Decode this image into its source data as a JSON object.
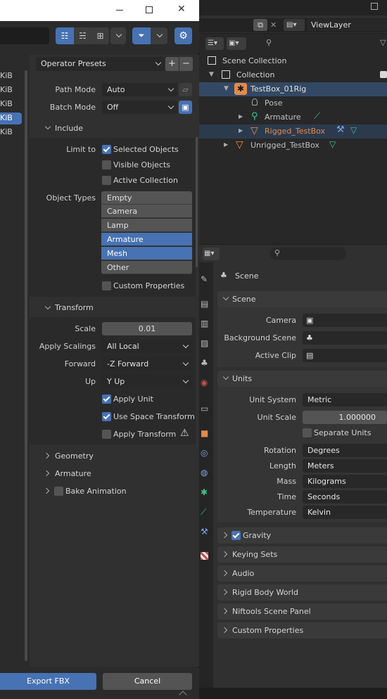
{
  "topbar": {
    "view_layer": "ViewLayer"
  },
  "outliner": {
    "rows": [
      {
        "label": "Scene Collection",
        "color": "#d0d0d0"
      },
      {
        "label": "Collection",
        "color": "#d0d0d0"
      },
      {
        "label": "TestBox_01Rig",
        "color": "#d0d0d0"
      },
      {
        "label": "Pose",
        "color": "#c0c0c0"
      },
      {
        "label": "Armature",
        "color": "#c0c0c0"
      },
      {
        "label": "Rigged_TestBox",
        "color": "#e38b4b"
      },
      {
        "label": "Unrigged_TestBox",
        "color": "#c0c0c0"
      }
    ]
  },
  "properties": {
    "context": "Scene",
    "scene_panel": {
      "title": "Scene",
      "camera_label": "Camera",
      "bg_scene_label": "Background Scene",
      "active_clip_label": "Active Clip"
    },
    "units_panel": {
      "title": "Units",
      "unit_system_label": "Unit System",
      "unit_system": "Metric",
      "unit_scale_label": "Unit Scale",
      "unit_scale": "1.000000",
      "separate_units": "Separate Units",
      "rotation_label": "Rotation",
      "rotation": "Degrees",
      "length_label": "Length",
      "length": "Meters",
      "mass_label": "Mass",
      "mass": "Kilograms",
      "time_label": "Time",
      "time": "Seconds",
      "temperature_label": "Temperature",
      "temperature": "Kelvin"
    },
    "collapsed_panels": [
      "Gravity",
      "Keying Sets",
      "Audio",
      "Rigid Body World",
      "Niftools Scene Panel",
      "Custom Properties"
    ]
  },
  "dialog": {
    "file_sizes": [
      "KiB",
      "KiB",
      "KiB",
      "KiB",
      "KiB"
    ],
    "operator_presets": "Operator Presets",
    "path_mode_label": "Path Mode",
    "path_mode": "Auto",
    "batch_mode_label": "Batch Mode",
    "batch_mode": "Off",
    "include": {
      "title": "Include",
      "limit_to_label": "Limit to",
      "selected_objects": "Selected Objects",
      "visible_objects": "Visible Objects",
      "active_collection": "Active Collection",
      "object_types_label": "Object Types",
      "object_types": [
        "Empty",
        "Camera",
        "Lamp",
        "Armature",
        "Mesh",
        "Other"
      ],
      "custom_properties": "Custom Properties"
    },
    "transform": {
      "title": "Transform",
      "scale_label": "Scale",
      "scale": "0.01",
      "apply_scalings_label": "Apply Scalings",
      "apply_scalings": "All Local",
      "forward_label": "Forward",
      "forward": "-Z Forward",
      "up_label": "Up",
      "up": "Y Up",
      "apply_unit": "Apply Unit",
      "use_space_transform": "Use Space Transform",
      "apply_transform": "Apply Transform"
    },
    "geometry": "Geometry",
    "armature": "Armature",
    "bake_animation": "Bake Animation",
    "export_button": "Export FBX",
    "cancel_button": "Cancel"
  },
  "colors": {
    "accent": "#4772b3",
    "selection": "#334864",
    "highlight_text": "#e38b4b"
  }
}
